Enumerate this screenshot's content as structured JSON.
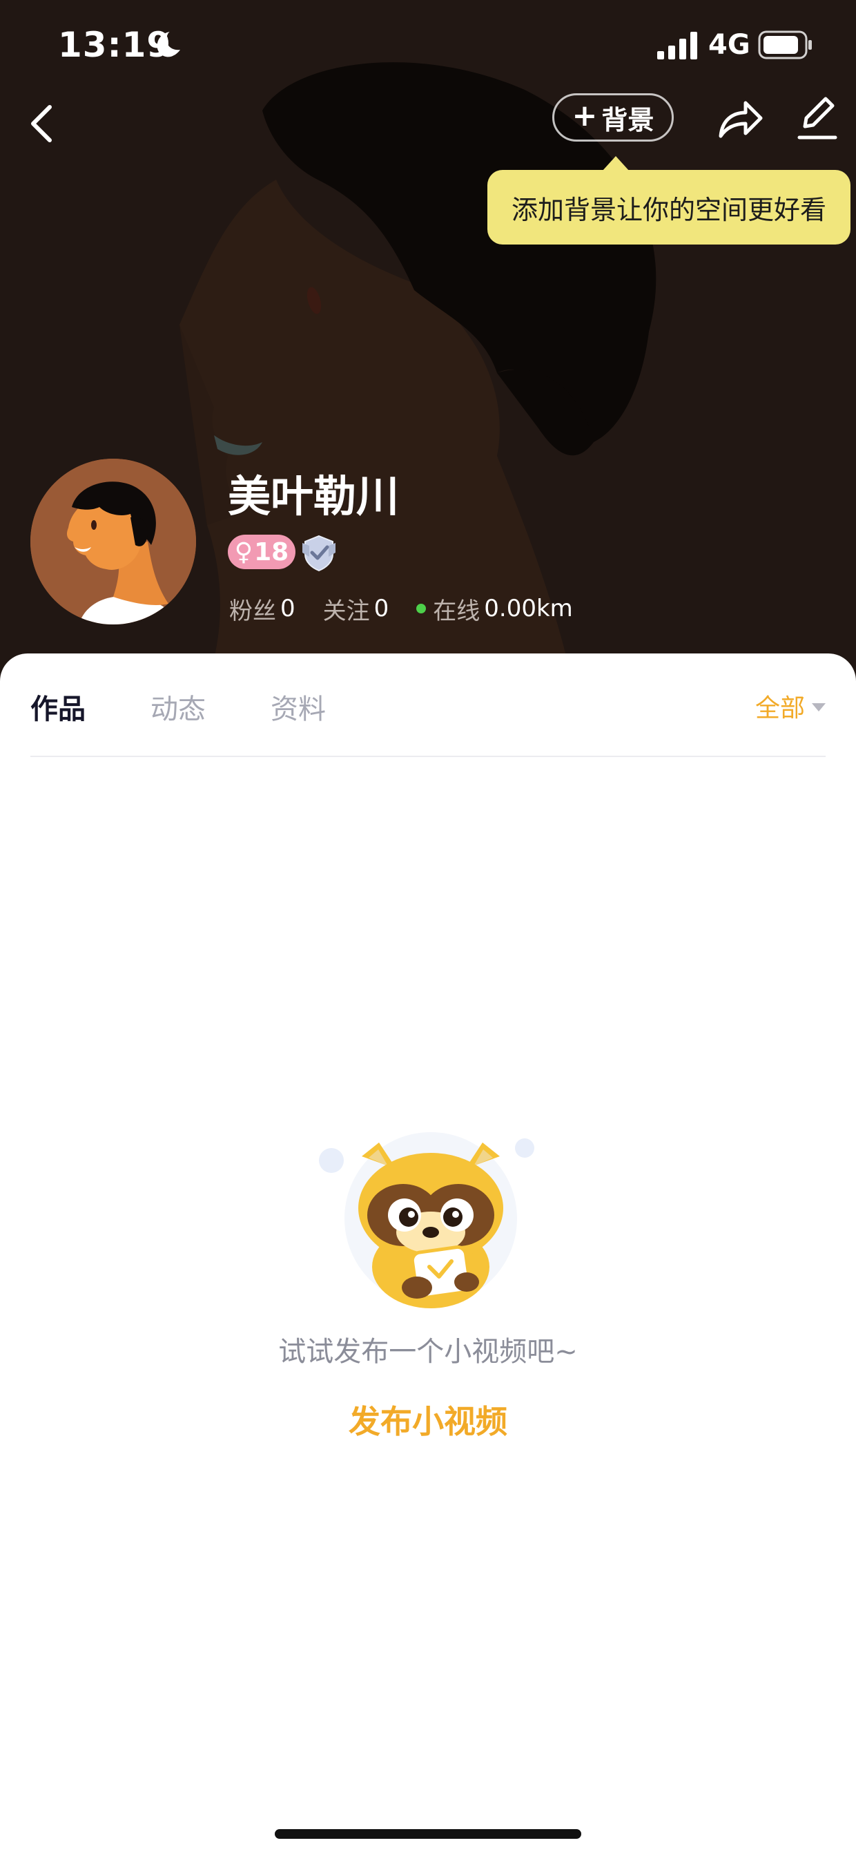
{
  "status_bar": {
    "time": "13:19",
    "network": "4G"
  },
  "nav": {
    "background_button_plus": "+",
    "background_button_label": "背景"
  },
  "tooltip": {
    "text": "添加背景让你的空间更好看"
  },
  "profile": {
    "username": "美叶勒川",
    "gender_symbol": "♀",
    "age": "18",
    "fans_label": "粉丝",
    "fans_count": "0",
    "follow_label": "关注",
    "follow_count": "0",
    "online_label": "在线",
    "distance": "0.00km"
  },
  "tabs": [
    {
      "label": "作品",
      "active": true
    },
    {
      "label": "动态",
      "active": false
    },
    {
      "label": "资料",
      "active": false
    }
  ],
  "filter": {
    "label": "全部"
  },
  "empty_state": {
    "message": "试试发布一个小视频吧~",
    "action_label": "发布小视频"
  },
  "colors": {
    "accent": "#f2aa28",
    "tooltip_bg": "#f1e67d",
    "online": "#4dd04a",
    "header_bg": "#211713",
    "gender_badge": "#f29ab3"
  },
  "icons": [
    "moon-icon",
    "signal-icon",
    "battery-icon",
    "back-icon",
    "plus-icon",
    "share-icon",
    "edit-icon",
    "verified-badge-icon",
    "caret-down-icon"
  ]
}
